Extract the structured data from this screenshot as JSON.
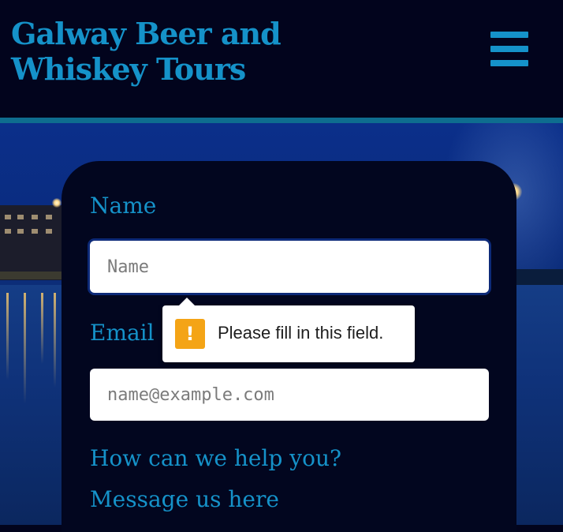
{
  "header": {
    "title_line1": "Galway Beer and",
    "title_line2": "Whiskey Tours",
    "menu_icon": "hamburger-menu-icon"
  },
  "form": {
    "name_label": "Name",
    "name_placeholder": "Name",
    "email_label": "Email",
    "email_placeholder": "name@example.com",
    "help_label": "How can we help you?",
    "message_label": "Message us here"
  },
  "validation": {
    "icon": "warning-icon",
    "icon_glyph": "!",
    "message": "Please fill in this field."
  },
  "colors": {
    "background": "#02041d",
    "accent": "#1592c9",
    "warning": "#f4a416"
  }
}
